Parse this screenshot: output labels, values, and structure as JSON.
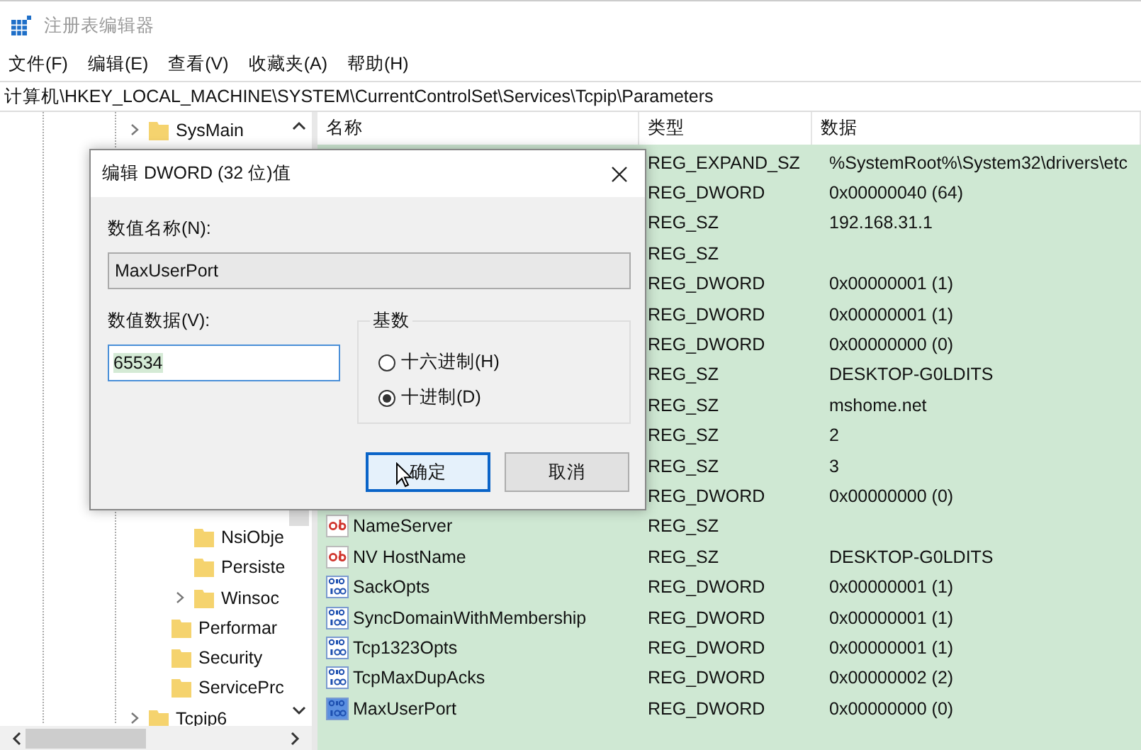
{
  "window": {
    "title": "注册表编辑器"
  },
  "menu": [
    "文件(F)",
    "编辑(E)",
    "查看(V)",
    "收藏夹(A)",
    "帮助(H)"
  ],
  "address": "计算机\\HKEY_LOCAL_MACHINE\\SYSTEM\\CurrentControlSet\\Services\\Tcpip\\Parameters",
  "tree": {
    "top_item": {
      "label": "SysMain",
      "expandable": true
    },
    "items": [
      {
        "label": "NsiObje",
        "expandable": false
      },
      {
        "label": "Persiste",
        "expandable": false
      },
      {
        "label": "Winsoc",
        "expandable": true
      }
    ],
    "siblings": [
      {
        "label": "Performar",
        "expandable": false
      },
      {
        "label": "Security",
        "expandable": false
      },
      {
        "label": "ServicePrc",
        "expandable": false
      }
    ],
    "parent_siblings": [
      {
        "label": "Tcpip6",
        "expandable": true
      }
    ]
  },
  "table": {
    "columns": [
      "名称",
      "类型",
      "数据"
    ],
    "rows": [
      {
        "type": "REG_EXPAND_SZ",
        "data": "%SystemRoot%\\System32\\drivers\\etc"
      },
      {
        "type": "REG_DWORD",
        "data": "0x00000040 (64)"
      },
      {
        "type": "REG_SZ",
        "data": "192.168.31.1"
      },
      {
        "type": "REG_SZ"
      },
      {
        "type": "REG_DWORD",
        "data": "0x00000001 (1)"
      },
      {
        "type": "REG_DWORD",
        "data": "0x00000001 (1)"
      },
      {
        "type": "REG_DWORD",
        "data": "0x00000000 (0)"
      },
      {
        "type": "REG_SZ",
        "data": "DESKTOP-G0LDITS"
      },
      {
        "type": "REG_SZ",
        "data": "mshome.net"
      },
      {
        "type": "REG_SZ",
        "data": "2"
      },
      {
        "type": "REG_SZ",
        "data": "3"
      },
      {
        "type": "REG_DWORD",
        "data": "0x00000000 (0)"
      },
      {
        "kind": "string",
        "name": "NameServer",
        "type": "REG_SZ",
        "selected": false
      },
      {
        "kind": "string",
        "name": "NV HostName",
        "type": "REG_SZ",
        "data": "DESKTOP-G0LDITS",
        "selected": false
      },
      {
        "kind": "binary",
        "name": "SackOpts",
        "type": "REG_DWORD",
        "data": "0x00000001 (1)",
        "selected": false
      },
      {
        "kind": "binary",
        "name": "SyncDomainWithMembership",
        "type": "REG_DWORD",
        "data": "0x00000001 (1)",
        "selected": false
      },
      {
        "kind": "binary",
        "name": "Tcp1323Opts",
        "type": "REG_DWORD",
        "data": "0x00000001 (1)",
        "selected": false
      },
      {
        "kind": "binary",
        "name": "TcpMaxDupAcks",
        "type": "REG_DWORD",
        "data": "0x00000002 (2)",
        "selected": false
      },
      {
        "kind": "binary",
        "name": "MaxUserPort",
        "type": "REG_DWORD",
        "data": "0x00000000 (0)",
        "selected": true
      }
    ]
  },
  "dialog": {
    "title": "编辑 DWORD (32 位)值",
    "name_label": "数值名称(N):",
    "name_value": "MaxUserPort",
    "data_label": "数值数据(V):",
    "data_value": "65534",
    "base_label": "基数",
    "bases": [
      {
        "label": "十六进制(H)",
        "selected": false
      },
      {
        "label": "十进制(D)",
        "selected": true
      }
    ],
    "buttons": [
      {
        "label": "确定",
        "focused": true
      },
      {
        "label": "取消",
        "focused": false
      }
    ]
  }
}
